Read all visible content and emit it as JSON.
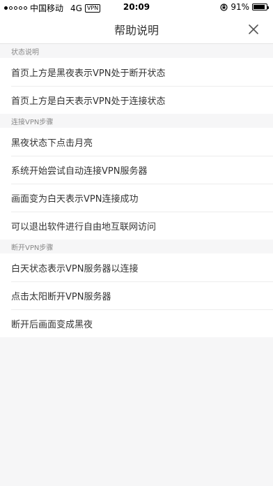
{
  "status_bar": {
    "carrier": "中国移动",
    "network": "4G",
    "vpn": "VPN",
    "time": "20:09",
    "battery": "91%",
    "battery_level": 0.91,
    "signal_bars_filled": 1,
    "signal_bars_total": 5
  },
  "nav": {
    "title": "帮助说明",
    "close_icon": "close-icon"
  },
  "sections": [
    {
      "header": "状态说明",
      "items": [
        "首页上方是黑夜表示VPN处于断开状态",
        "首页上方是白天表示VPN处于连接状态"
      ]
    },
    {
      "header": "连接VPN步骤",
      "items": [
        "黑夜状态下点击月亮",
        "系统开始尝试自动连接VPN服务器",
        "画面变为白天表示VPN连接成功",
        "可以退出软件进行自由地互联网访问"
      ]
    },
    {
      "header": "断开VPN步骤",
      "items": [
        "白天状态表示VPN服务器以连接",
        "点击太阳断开VPN服务器",
        "断开后画面变成黑夜"
      ]
    }
  ]
}
